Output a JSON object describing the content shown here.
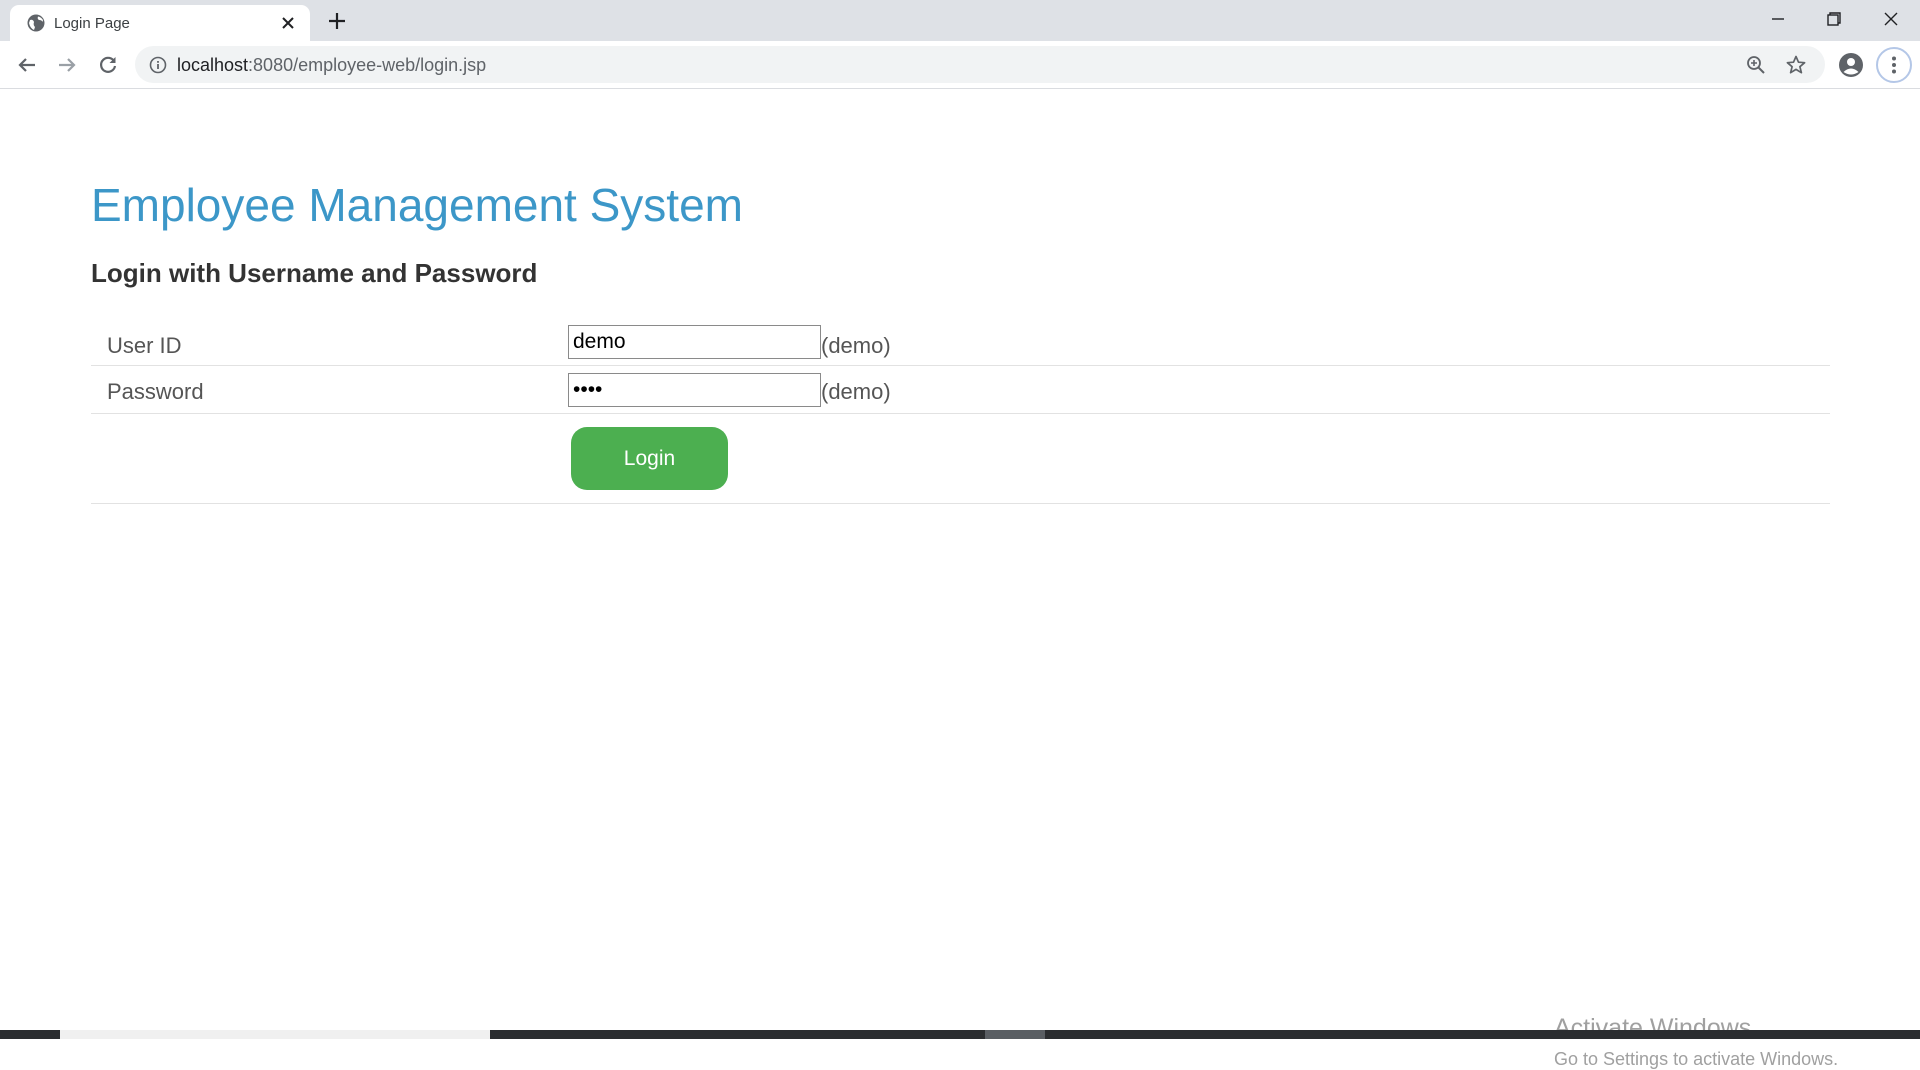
{
  "browser": {
    "tab_title": "Login Page",
    "url_host": "localhost",
    "url_rest": ":8080/employee-web/login.jsp",
    "icons": {
      "favicon": "globe-icon",
      "tab_close": "close-icon",
      "new_tab": "plus-icon",
      "back": "arrow-left-icon",
      "forward": "arrow-right-icon",
      "reload": "reload-icon",
      "site_info": "info-icon",
      "zoom": "zoom-icon",
      "bookmark": "star-icon",
      "profile": "profile-icon",
      "menu": "kebab-menu-icon",
      "minimize": "minimize-icon",
      "restore": "restore-icon",
      "close_window": "close-icon"
    }
  },
  "page": {
    "title": "Employee Management System",
    "subtitle": "Login with Username and Password",
    "form": {
      "user_label": "User ID",
      "user_value": "demo",
      "user_hint": "(demo)",
      "password_label": "Password",
      "password_value": "demo",
      "password_hint": "(demo)",
      "login_button": "Login"
    }
  },
  "watermark": {
    "title": "Activate Windows",
    "subtitle": "Go to Settings to activate Windows."
  },
  "colors": {
    "title": "#3c97c8",
    "login_button": "#4caf50",
    "tabstrip": "#dee1e6"
  }
}
